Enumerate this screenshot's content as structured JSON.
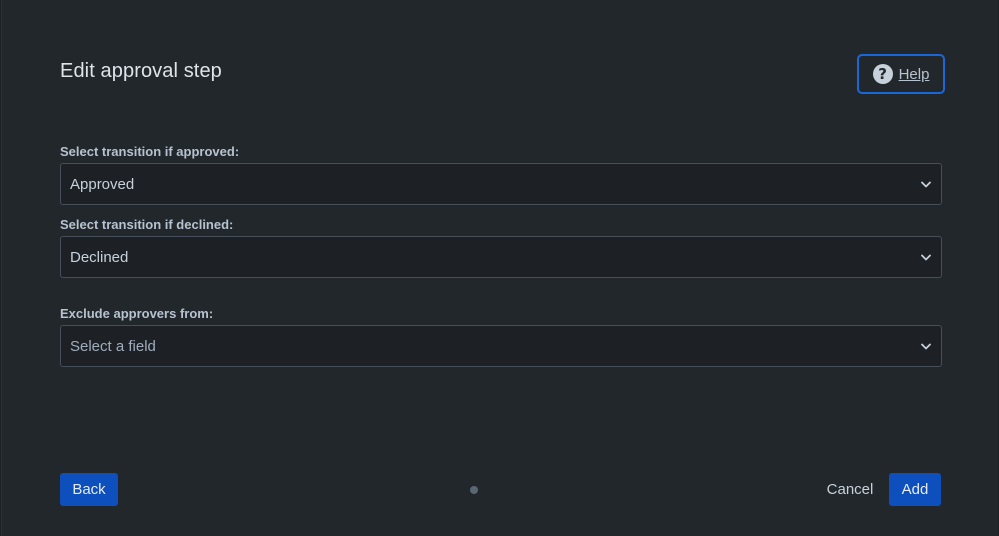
{
  "dialog": {
    "title": "Edit approval step",
    "help_label": "Help"
  },
  "fields": [
    {
      "label": "Select transition if approved:",
      "value": "Approved",
      "placeholder": ""
    },
    {
      "label": "Select transition if declined:",
      "value": "Declined",
      "placeholder": ""
    },
    {
      "label": "Exclude approvers from:",
      "value": "",
      "placeholder": "Select a field"
    }
  ],
  "footer": {
    "back_label": "Back",
    "cancel_label": "Cancel",
    "add_label": "Add"
  },
  "icons": {
    "help": "question-circle-icon",
    "dropdown": "chevron-down-icon"
  },
  "colors": {
    "background": "#22272b",
    "primary_button": "#0c4fbd",
    "focus_ring": "#1a67d8"
  }
}
